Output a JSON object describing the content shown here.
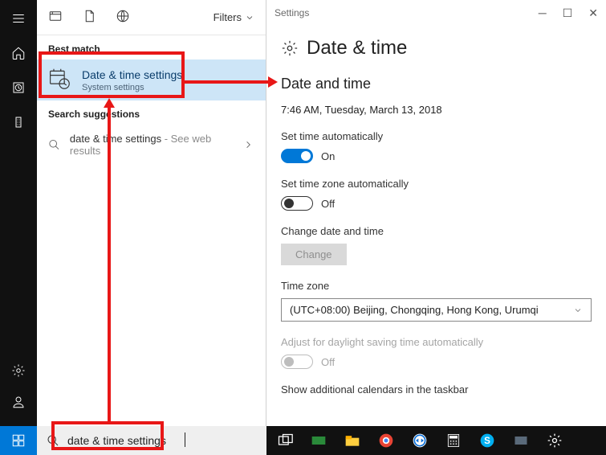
{
  "search": {
    "filters_label": "Filters",
    "best_match_header": "Best match",
    "best_match": {
      "title": "Date & time settings",
      "subtitle": "System settings"
    },
    "suggestions_header": "Search suggestions",
    "suggestion": {
      "text": "date & time settings",
      "hint": " - See web results"
    },
    "input_value": "date & time settings"
  },
  "settings": {
    "window_title": "Settings",
    "page_title": "Date & time",
    "section_title": "Date and time",
    "current_time": "7:46 AM, Tuesday, March 13, 2018",
    "auto_time": {
      "label": "Set time automatically",
      "state": "On"
    },
    "auto_tz": {
      "label": "Set time zone automatically",
      "state": "Off"
    },
    "change_dt": {
      "label": "Change date and time",
      "button": "Change"
    },
    "tz": {
      "label": "Time zone",
      "value": "(UTC+08:00) Beijing, Chongqing, Hong Kong, Urumqi"
    },
    "dst": {
      "label": "Adjust for daylight saving time automatically",
      "state": "Off"
    },
    "additional_cal_label": "Show additional calendars in the taskbar"
  }
}
